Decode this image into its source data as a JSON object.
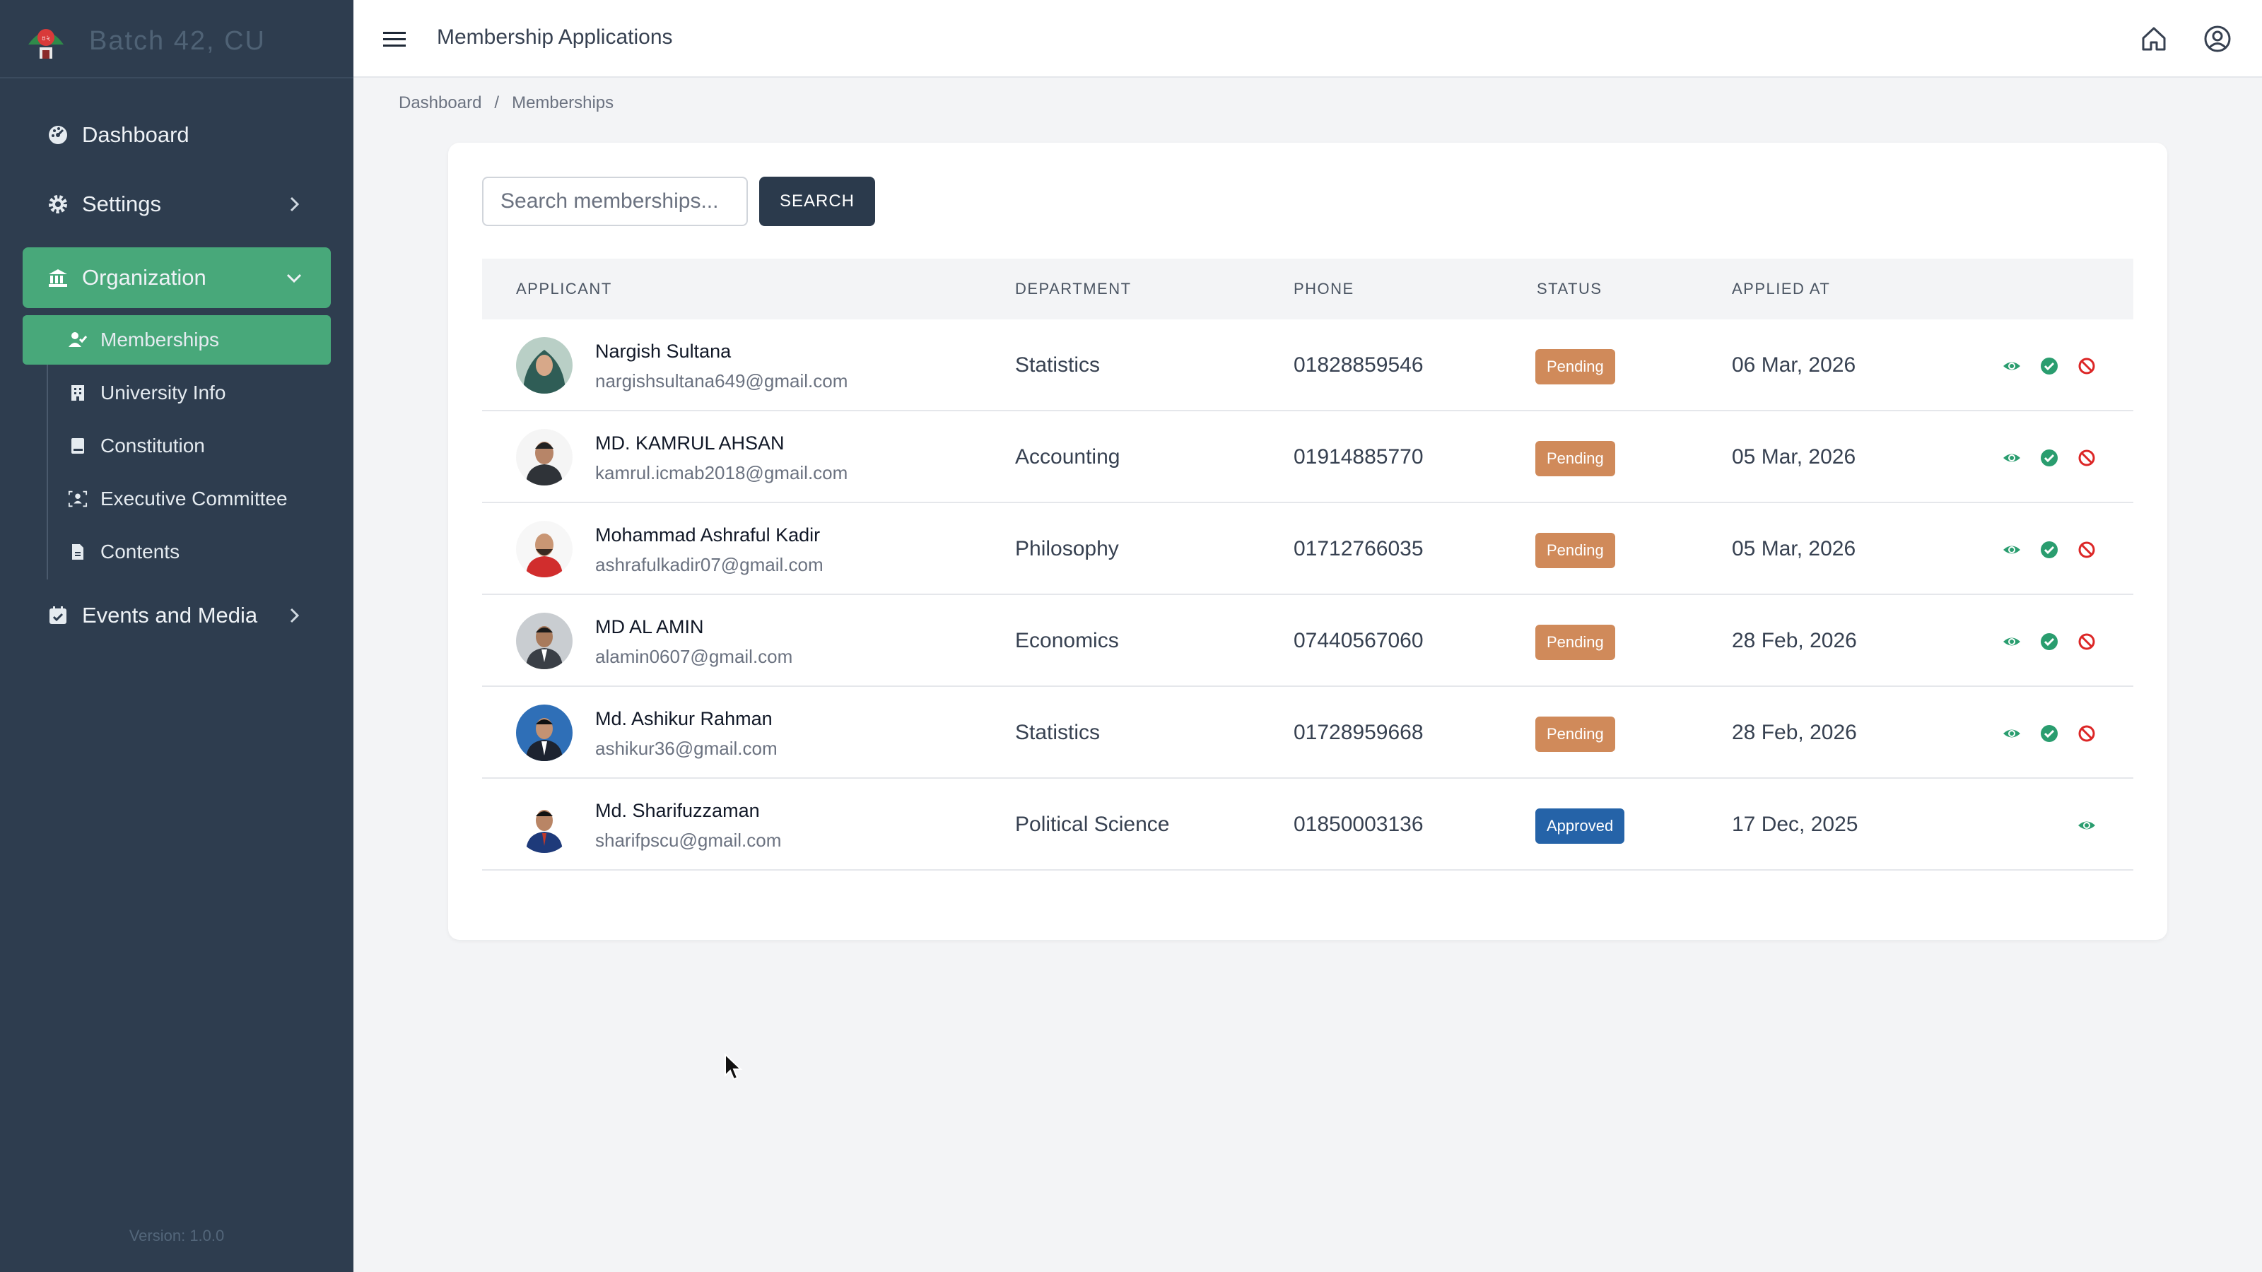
{
  "sidebar": {
    "brand": "Batch 42, CU",
    "items": [
      {
        "label": "Dashboard",
        "icon": "dashboard-icon"
      },
      {
        "label": "Settings",
        "icon": "gear-icon"
      },
      {
        "label": "Organization",
        "icon": "bank-icon"
      },
      {
        "label": "Events and Media",
        "icon": "calendar-check-icon"
      }
    ],
    "subitems": [
      {
        "label": "Memberships",
        "icon": "user-check-icon"
      },
      {
        "label": "University Info",
        "icon": "building-icon"
      },
      {
        "label": "Constitution",
        "icon": "book-icon"
      },
      {
        "label": "Executive Committee",
        "icon": "team-icon"
      },
      {
        "label": "Contents",
        "icon": "document-icon"
      }
    ],
    "version": "Version: 1.0.0"
  },
  "header": {
    "title": "Membership Applications"
  },
  "breadcrumb": {
    "home": "Dashboard",
    "separator": "/",
    "current": "Memberships"
  },
  "search": {
    "placeholder": "Search memberships...",
    "button": "SEARCH"
  },
  "table": {
    "columns": [
      "APPLICANT",
      "DEPARTMENT",
      "PHONE",
      "STATUS",
      "APPLIED AT"
    ],
    "rows": [
      {
        "name": "Nargish Sultana",
        "email": "nargishsultana649@gmail.com",
        "department": "Statistics",
        "phone": "01828859546",
        "status": "Pending",
        "applied_at": "06 Mar, 2026"
      },
      {
        "name": "MD. KAMRUL AHSAN",
        "email": "kamrul.icmab2018@gmail.com",
        "department": "Accounting",
        "phone": "01914885770",
        "status": "Pending",
        "applied_at": "05 Mar, 2026"
      },
      {
        "name": "Mohammad Ashraful Kadir",
        "email": "ashrafulkadir07@gmail.com",
        "department": "Philosophy",
        "phone": "01712766035",
        "status": "Pending",
        "applied_at": "05 Mar, 2026"
      },
      {
        "name": "MD AL AMIN",
        "email": "alamin0607@gmail.com",
        "department": "Economics",
        "phone": "07440567060",
        "status": "Pending",
        "applied_at": "28 Feb, 2026"
      },
      {
        "name": "Md. Ashikur Rahman",
        "email": "ashikur36@gmail.com",
        "department": "Statistics",
        "phone": "01728959668",
        "status": "Pending",
        "applied_at": "28 Feb, 2026"
      },
      {
        "name": "Md. Sharifuzzaman",
        "email": "sharifpscu@gmail.com",
        "department": "Political Science",
        "phone": "01850003136",
        "status": "Approved",
        "applied_at": "17 Dec, 2025"
      }
    ]
  },
  "colors": {
    "sidebar_bg": "#2e3d4f",
    "accent": "#48a87a",
    "pending": "#d08a5a",
    "approved": "#2563a8",
    "reject": "#dc2626"
  }
}
